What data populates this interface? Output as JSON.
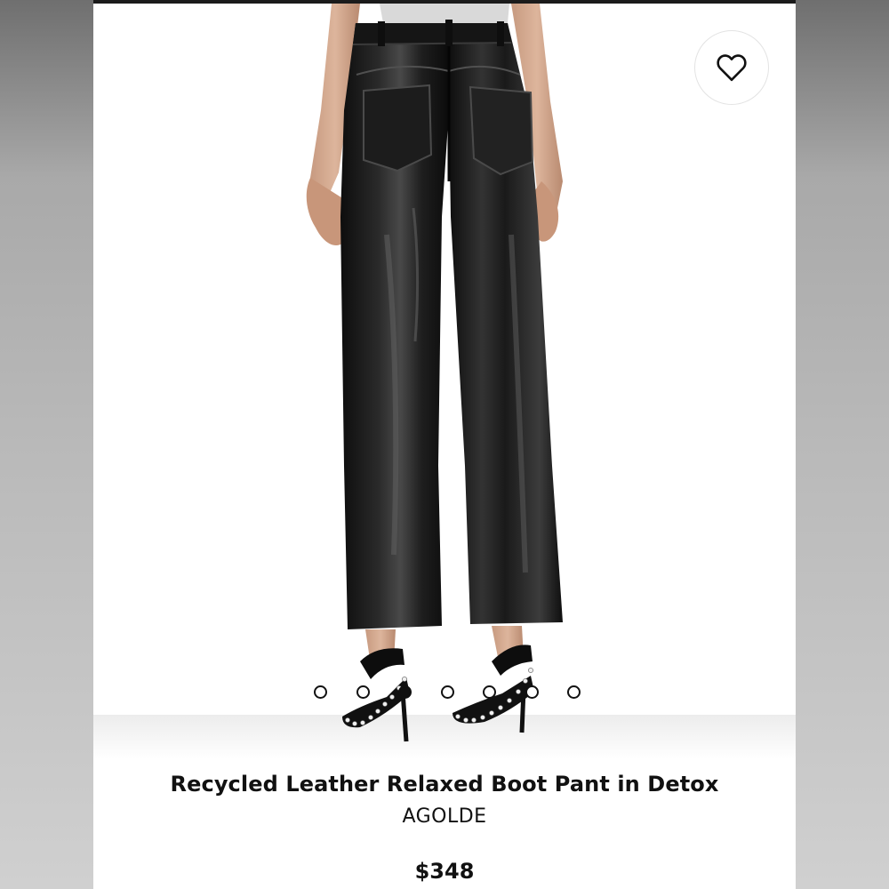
{
  "product": {
    "title": "Recycled Leather Relaxed Boot Pant in Detox",
    "brand": "AGOLDE",
    "price": "$348"
  },
  "gallery": {
    "image_subject": "black leather boot-cut pants, back view, worn with studded strappy heels",
    "dot_count": 7,
    "active_index": 2
  },
  "icons": {
    "wishlist": "heart-outline-icon"
  },
  "colors": {
    "text": "#111111",
    "background": "#ffffff",
    "leather": "#1a1a1a"
  }
}
